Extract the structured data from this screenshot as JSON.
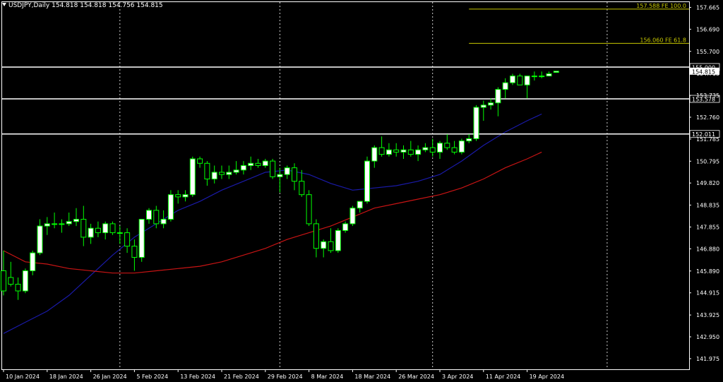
{
  "header": {
    "symbol_label": "USDJPY,Daily",
    "open": "154.818",
    "high": "154.818",
    "low": "154.756",
    "close": "154.815"
  },
  "colors": {
    "background": "#000000",
    "frame": "#ffffff",
    "bull_body": "#ffffff",
    "bear_body": "#000000",
    "wick": "#00ff00",
    "ma_fast": "#1a1aa8",
    "ma_slow": "#c81414",
    "fib_line": "#c8c800",
    "price_level": "#ffffff"
  },
  "chart_data": {
    "type": "candlestick",
    "symbol": "USDJPY",
    "timeframe": "Daily",
    "ylim": [
      141.5,
      157.9
    ],
    "y_ticks": [
      "157.665",
      "156.690",
      "155.700",
      "154.715",
      "153.735",
      "152.760",
      "151.785",
      "150.795",
      "149.820",
      "148.835",
      "147.855",
      "146.880",
      "145.890",
      "144.915",
      "143.925",
      "142.950",
      "141.975"
    ],
    "x_ticks": [
      {
        "label": "10 Jan 2024",
        "index": 0
      },
      {
        "label": "18 Jan 2024",
        "index": 6
      },
      {
        "label": "26 Jan 2024",
        "index": 12
      },
      {
        "label": "5 Feb 2024",
        "index": 18
      },
      {
        "label": "13 Feb 2024",
        "index": 24
      },
      {
        "label": "21 Feb 2024",
        "index": 30
      },
      {
        "label": "29 Feb 2024",
        "index": 36
      },
      {
        "label": "8 Mar 2024",
        "index": 42
      },
      {
        "label": "18 Mar 2024",
        "index": 48
      },
      {
        "label": "26 Mar 2024",
        "index": 54
      },
      {
        "label": "3 Apr 2024",
        "index": 60
      },
      {
        "label": "11 Apr 2024",
        "index": 66
      },
      {
        "label": "19 Apr 2024",
        "index": 72
      }
    ],
    "candles": [
      [
        145.9,
        146.8,
        144.8,
        145.0
      ],
      [
        145.6,
        146.3,
        145.2,
        145.3
      ],
      [
        145.3,
        145.6,
        144.6,
        145.0
      ],
      [
        145.0,
        146.0,
        144.9,
        145.9
      ],
      [
        145.9,
        146.8,
        145.7,
        146.7
      ],
      [
        146.7,
        148.2,
        146.6,
        147.9
      ],
      [
        147.9,
        148.3,
        147.5,
        148.0
      ],
      [
        148.0,
        148.5,
        147.8,
        148.0
      ],
      [
        148.0,
        148.2,
        147.6,
        148.0
      ],
      [
        148.0,
        148.5,
        147.9,
        148.1
      ],
      [
        148.1,
        148.7,
        147.9,
        148.2
      ],
      [
        148.2,
        148.8,
        147.0,
        147.4
      ],
      [
        147.4,
        148.0,
        147.1,
        147.8
      ],
      [
        147.8,
        148.1,
        147.4,
        147.6
      ],
      [
        147.6,
        148.1,
        147.3,
        148.0
      ],
      [
        148.0,
        148.1,
        147.5,
        147.6
      ],
      [
        147.6,
        147.9,
        147.1,
        147.6
      ],
      [
        147.6,
        147.8,
        146.7,
        147.0
      ],
      [
        147.0,
        147.3,
        145.9,
        146.5
      ],
      [
        146.5,
        148.2,
        146.3,
        148.2
      ],
      [
        148.2,
        148.7,
        148.0,
        148.6
      ],
      [
        148.6,
        148.8,
        147.8,
        148.0
      ],
      [
        148.0,
        148.6,
        147.8,
        148.2
      ],
      [
        148.2,
        149.5,
        148.1,
        149.3
      ],
      [
        149.3,
        149.5,
        148.9,
        149.2
      ],
      [
        149.2,
        149.5,
        149.0,
        149.3
      ],
      [
        149.3,
        151.0,
        149.2,
        150.9
      ],
      [
        150.9,
        151.0,
        150.5,
        150.7
      ],
      [
        150.7,
        150.8,
        149.7,
        150.0
      ],
      [
        150.0,
        150.6,
        149.8,
        150.3
      ],
      [
        150.3,
        150.6,
        150.0,
        150.2
      ],
      [
        150.2,
        150.6,
        150.0,
        150.3
      ],
      [
        150.3,
        150.8,
        150.2,
        150.4
      ],
      [
        150.4,
        150.8,
        150.2,
        150.6
      ],
      [
        150.6,
        151.0,
        150.4,
        150.7
      ],
      [
        150.7,
        150.9,
        150.5,
        150.6
      ],
      [
        150.6,
        150.9,
        150.5,
        150.8
      ],
      [
        150.8,
        150.9,
        150.0,
        150.1
      ],
      [
        150.1,
        150.5,
        149.4,
        150.2
      ],
      [
        150.2,
        150.6,
        150.0,
        150.5
      ],
      [
        150.5,
        150.7,
        149.5,
        149.9
      ],
      [
        149.9,
        150.4,
        149.2,
        149.3
      ],
      [
        149.3,
        149.5,
        147.9,
        148.0
      ],
      [
        148.0,
        148.2,
        146.5,
        146.9
      ],
      [
        146.9,
        147.3,
        146.5,
        147.2
      ],
      [
        147.2,
        147.8,
        146.7,
        146.8
      ],
      [
        146.8,
        147.8,
        146.7,
        147.7
      ],
      [
        147.7,
        148.1,
        147.6,
        148.0
      ],
      [
        148.0,
        148.8,
        147.9,
        148.7
      ],
      [
        148.7,
        149.0,
        148.5,
        149.0
      ],
      [
        149.0,
        151.0,
        148.9,
        150.8
      ],
      [
        150.8,
        151.5,
        150.5,
        151.4
      ],
      [
        151.4,
        151.9,
        151.0,
        151.1
      ],
      [
        151.1,
        151.6,
        151.0,
        151.3
      ],
      [
        151.3,
        151.6,
        151.0,
        151.2
      ],
      [
        151.2,
        151.5,
        150.9,
        151.3
      ],
      [
        151.3,
        151.7,
        151.0,
        151.1
      ],
      [
        151.1,
        151.5,
        150.8,
        151.3
      ],
      [
        151.3,
        151.6,
        151.2,
        151.4
      ],
      [
        151.4,
        151.8,
        151.0,
        151.2
      ],
      [
        151.2,
        151.7,
        150.9,
        151.6
      ],
      [
        151.6,
        152.0,
        151.3,
        151.4
      ],
      [
        151.4,
        151.7,
        151.1,
        151.2
      ],
      [
        151.2,
        151.8,
        151.1,
        151.7
      ],
      [
        151.7,
        152.0,
        151.6,
        151.8
      ],
      [
        151.8,
        153.3,
        151.7,
        153.2
      ],
      [
        153.2,
        153.5,
        152.6,
        153.3
      ],
      [
        153.3,
        153.6,
        153.1,
        153.4
      ],
      [
        153.4,
        154.1,
        152.8,
        154.0
      ],
      [
        154.0,
        154.5,
        153.6,
        154.3
      ],
      [
        154.3,
        154.7,
        154.2,
        154.6
      ],
      [
        154.6,
        154.7,
        154.2,
        154.2
      ],
      [
        154.2,
        154.6,
        153.6,
        154.6
      ],
      [
        154.6,
        154.8,
        154.4,
        154.6
      ],
      [
        154.6,
        154.8,
        154.5,
        154.6
      ],
      [
        154.6,
        154.8,
        154.6,
        154.7
      ],
      [
        154.76,
        154.818,
        154.756,
        154.815
      ]
    ],
    "ma_fast": [
      [
        0,
        143.1
      ],
      [
        3,
        143.6
      ],
      [
        6,
        144.1
      ],
      [
        9,
        144.8
      ],
      [
        12,
        145.7
      ],
      [
        15,
        146.6
      ],
      [
        18,
        147.4
      ],
      [
        21,
        148.0
      ],
      [
        24,
        148.6
      ],
      [
        27,
        149.0
      ],
      [
        30,
        149.5
      ],
      [
        33,
        149.9
      ],
      [
        36,
        150.3
      ],
      [
        39,
        150.4
      ],
      [
        42,
        150.2
      ],
      [
        45,
        149.8
      ],
      [
        48,
        149.5
      ],
      [
        51,
        149.6
      ],
      [
        54,
        149.7
      ],
      [
        57,
        149.9
      ],
      [
        60,
        150.2
      ],
      [
        63,
        150.8
      ],
      [
        66,
        151.5
      ],
      [
        69,
        152.1
      ],
      [
        72,
        152.6
      ],
      [
        74,
        152.9
      ]
    ],
    "ma_slow": [
      [
        0,
        146.8
      ],
      [
        3,
        146.3
      ],
      [
        6,
        146.2
      ],
      [
        9,
        146.0
      ],
      [
        12,
        145.9
      ],
      [
        15,
        145.8
      ],
      [
        18,
        145.8
      ],
      [
        21,
        145.9
      ],
      [
        24,
        146.0
      ],
      [
        27,
        146.1
      ],
      [
        30,
        146.3
      ],
      [
        33,
        146.6
      ],
      [
        36,
        146.9
      ],
      [
        39,
        147.3
      ],
      [
        42,
        147.6
      ],
      [
        45,
        147.9
      ],
      [
        48,
        148.3
      ],
      [
        51,
        148.7
      ],
      [
        54,
        148.9
      ],
      [
        57,
        149.1
      ],
      [
        60,
        149.3
      ],
      [
        63,
        149.6
      ],
      [
        66,
        150.0
      ],
      [
        69,
        150.5
      ],
      [
        72,
        150.9
      ],
      [
        74,
        151.2
      ]
    ],
    "fib_levels": [
      {
        "price": 157.588,
        "label": "157.588 FE 100.0",
        "start_index": 64
      },
      {
        "price": 156.06,
        "label": "156.060 FE 61.8",
        "start_index": 64
      }
    ],
    "horizontal_levels": [
      {
        "price": 155.0,
        "label": "155.000"
      },
      {
        "price": 153.578,
        "label": "153.578"
      },
      {
        "price": 152.011,
        "label": "152.011"
      }
    ],
    "current_price": {
      "price": 154.815,
      "label": "154.815"
    },
    "period_separators_index": [
      16,
      38,
      59,
      83
    ]
  }
}
